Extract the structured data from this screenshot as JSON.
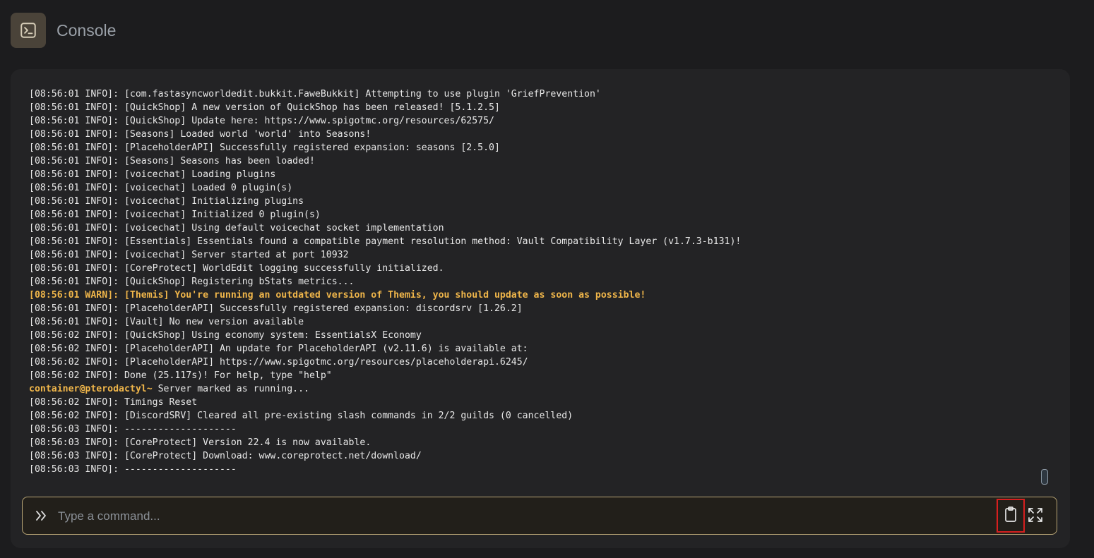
{
  "header": {
    "title": "Console",
    "icon": "terminal-icon"
  },
  "console": {
    "lines": [
      {
        "text": "[08:56:01 INFO]: [com.fastasyncworldedit.bukkit.FaweBukkit] Attempting to use plugin 'GriefPrevention'"
      },
      {
        "text": "[08:56:01 INFO]: [QuickShop] A new version of QuickShop has been released! [5.1.2.5]"
      },
      {
        "text": "[08:56:01 INFO]: [QuickShop] Update here: https://www.spigotmc.org/resources/62575/"
      },
      {
        "text": "[08:56:01 INFO]: [Seasons] Loaded world 'world' into Seasons!"
      },
      {
        "text": "[08:56:01 INFO]: [PlaceholderAPI] Successfully registered expansion: seasons [2.5.0]"
      },
      {
        "text": "[08:56:01 INFO]: [Seasons] Seasons has been loaded!"
      },
      {
        "text": "[08:56:01 INFO]: [voicechat] Loading plugins"
      },
      {
        "text": "[08:56:01 INFO]: [voicechat] Loaded 0 plugin(s)"
      },
      {
        "text": "[08:56:01 INFO]: [voicechat] Initializing plugins"
      },
      {
        "text": "[08:56:01 INFO]: [voicechat] Initialized 0 plugin(s)"
      },
      {
        "text": "[08:56:01 INFO]: [voicechat] Using default voicechat socket implementation"
      },
      {
        "text": "[08:56:01 INFO]: [Essentials] Essentials found a compatible payment resolution method: Vault Compatibility Layer (v1.7.3-b131)!"
      },
      {
        "text": "[08:56:01 INFO]: [voicechat] Server started at port 10932"
      },
      {
        "text": "[08:56:01 INFO]: [CoreProtect] WorldEdit logging successfully initialized."
      },
      {
        "text": "[08:56:01 INFO]: [QuickShop] Registering bStats metrics..."
      },
      {
        "text": "[08:56:01 WARN]: [Themis] You're running an outdated version of Themis, you should update as soon as possible!",
        "level": "warn"
      },
      {
        "text": "[08:56:01 INFO]: [PlaceholderAPI] Successfully registered expansion: discordsrv [1.26.2]"
      },
      {
        "text": "[08:56:01 INFO]: [Vault] No new version available"
      },
      {
        "text": "[08:56:02 INFO]: [QuickShop] Using economy system: EssentialsX Economy"
      },
      {
        "text": "[08:56:02 INFO]: [PlaceholderAPI] An update for PlaceholderAPI (v2.11.6) is available at:"
      },
      {
        "text": "[08:56:02 INFO]: [PlaceholderAPI] https://www.spigotmc.org/resources/placeholderapi.6245/"
      },
      {
        "text": "[08:56:02 INFO]: Done (25.117s)! For help, type \"help\""
      },
      {
        "prompt": "container@pterodactyl~",
        "text": " Server marked as running..."
      },
      {
        "text": "[08:56:02 INFO]: Timings Reset"
      },
      {
        "text": "[08:56:02 INFO]: [DiscordSRV] Cleared all pre-existing slash commands in 2/2 guilds (0 cancelled)"
      },
      {
        "text": "[08:56:03 INFO]: --------------------"
      },
      {
        "text": "[08:56:03 INFO]: [CoreProtect] Version 22.4 is now available."
      },
      {
        "text": "[08:56:03 INFO]: [CoreProtect] Download: www.coreprotect.net/download/"
      },
      {
        "text": "[08:56:03 INFO]: --------------------"
      }
    ]
  },
  "command": {
    "placeholder": "Type a command...",
    "value": "",
    "prefix_icon": "double-chevron-right-icon",
    "copy_icon": "clipboard-icon",
    "expand_icon": "expand-icon"
  },
  "colors": {
    "background": "#1c1c1e",
    "panel": "#232325",
    "warn": "#f0b64a",
    "prompt": "#f0b64a",
    "input_border": "#b9a676",
    "highlight_border": "#d61f1f"
  }
}
